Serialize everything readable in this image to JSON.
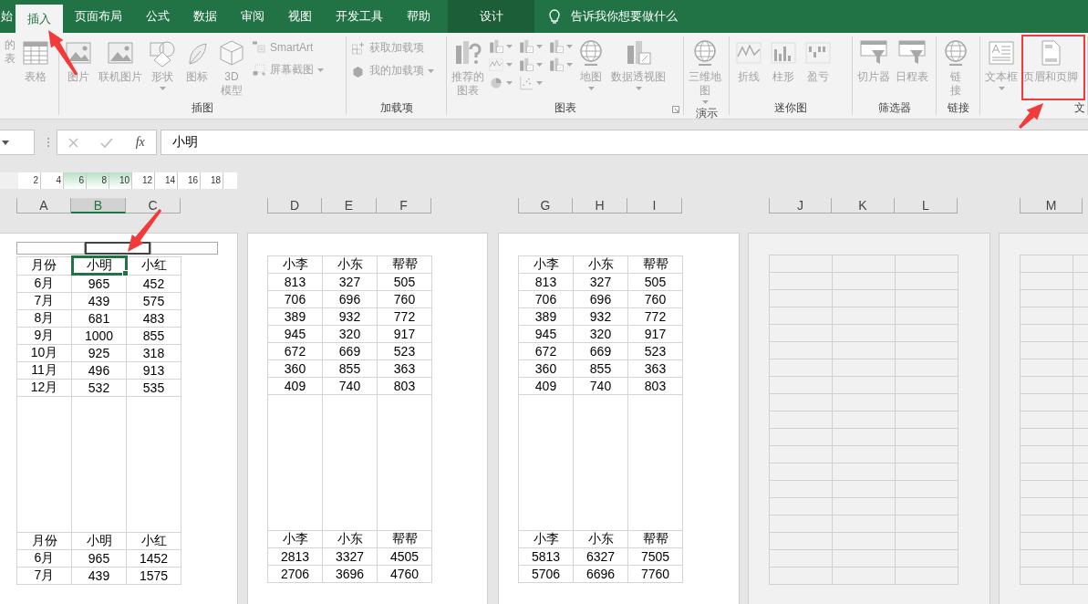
{
  "tabs": [
    {
      "label": "始",
      "selected": false,
      "kind": "normal"
    },
    {
      "label": "插入",
      "selected": true,
      "kind": "normal"
    },
    {
      "label": "页面布局",
      "selected": false,
      "kind": "normal"
    },
    {
      "label": "公式",
      "selected": false,
      "kind": "normal"
    },
    {
      "label": "数据",
      "selected": false,
      "kind": "normal"
    },
    {
      "label": "审阅",
      "selected": false,
      "kind": "normal"
    },
    {
      "label": "视图",
      "selected": false,
      "kind": "normal"
    },
    {
      "label": "开发工具",
      "selected": false,
      "kind": "normal"
    },
    {
      "label": "帮助",
      "selected": false,
      "kind": "normal"
    },
    {
      "label": "设计",
      "selected": false,
      "kind": "contextual"
    }
  ],
  "tell_me": "告诉我你想要做什么",
  "ribbon_groups": [
    {
      "buttons": [
        {
          "label": "的表",
          "kind": "large",
          "dropdown": false,
          "disabled": true
        },
        {
          "label": "表格",
          "kind": "large",
          "dropdown": false,
          "disabled": true
        }
      ]
    },
    {
      "label": "插图",
      "buttons": [
        {
          "label": "图片",
          "kind": "large",
          "dropdown": false,
          "disabled": true
        },
        {
          "label": "联机图片",
          "kind": "large",
          "dropdown": false,
          "disabled": true
        },
        {
          "label": "形状",
          "kind": "large",
          "dropdown": true,
          "disabled": true
        },
        {
          "label": "图标",
          "kind": "large",
          "dropdown": false,
          "disabled": true
        },
        {
          "label": "3D模型",
          "kind": "large",
          "dropdown": false,
          "disabled": true
        },
        {
          "label": "SmartArt",
          "kind": "small",
          "dropdown": false,
          "disabled": true
        },
        {
          "label": "屏幕截图",
          "kind": "small",
          "dropdown": true,
          "disabled": true
        }
      ]
    },
    {
      "label": "加载项",
      "buttons": [
        {
          "label": "获取加载项",
          "kind": "small",
          "dropdown": false,
          "disabled": true
        },
        {
          "label": "我的加载项",
          "kind": "small",
          "dropdown": true,
          "disabled": true
        }
      ]
    },
    {
      "label": "图表",
      "launcher": true,
      "buttons": [
        {
          "label": "推荐的图表",
          "kind": "large",
          "dropdown": false,
          "disabled": true
        },
        {
          "kind": "chart_grid",
          "disabled": true
        },
        {
          "label": "地图",
          "kind": "large",
          "dropdown": true,
          "disabled": true
        },
        {
          "label": "数据透视图",
          "kind": "large",
          "dropdown": true,
          "disabled": true
        }
      ]
    },
    {
      "label": "演示",
      "buttons": [
        {
          "label": "三维地图",
          "kind": "large",
          "dropdown": true,
          "disabled": true
        }
      ]
    },
    {
      "label": "迷你图",
      "buttons": [
        {
          "label": "折线",
          "kind": "large",
          "dropdown": false,
          "disabled": true
        },
        {
          "label": "柱形",
          "kind": "large",
          "dropdown": false,
          "disabled": true
        },
        {
          "label": "盈亏",
          "kind": "large",
          "dropdown": false,
          "disabled": true
        }
      ]
    },
    {
      "label": "筛选器",
      "buttons": [
        {
          "label": "切片器",
          "kind": "large",
          "dropdown": false,
          "disabled": true
        },
        {
          "label": "日程表",
          "kind": "large",
          "dropdown": false,
          "disabled": true
        }
      ]
    },
    {
      "label": "链接",
      "buttons": [
        {
          "label": "链接",
          "kind": "large",
          "dropdown": false,
          "disabled": true
        }
      ]
    },
    {
      "label": "文",
      "buttons": [
        {
          "label": "文本框",
          "kind": "large",
          "dropdown": true,
          "disabled": true
        },
        {
          "label": "页眉和页脚",
          "kind": "large",
          "dropdown": false,
          "disabled": true
        }
      ]
    }
  ],
  "formula_bar": {
    "function_label": "fx",
    "value": "小明"
  },
  "ruler": [
    {
      "label": "2",
      "highlighted": false
    },
    {
      "label": "4",
      "highlighted": false
    },
    {
      "label": "6",
      "highlighted": true
    },
    {
      "label": "8",
      "highlighted": true
    },
    {
      "label": "10",
      "highlighted": true
    },
    {
      "label": "12",
      "highlighted": false
    },
    {
      "label": "14",
      "highlighted": false
    },
    {
      "label": "16",
      "highlighted": false
    },
    {
      "label": "18",
      "highlighted": false
    }
  ],
  "pages": [
    {
      "kind": "printed",
      "columns": [
        {
          "label": "A",
          "selected": false
        },
        {
          "label": "B",
          "selected": true
        },
        {
          "label": "C",
          "selected": false
        }
      ],
      "header_sections": [
        {
          "selected": false
        },
        {
          "selected": true
        },
        {
          "selected": false
        }
      ],
      "blocks": [
        {
          "header": [
            {
              "text": "月份",
              "selected": false
            },
            {
              "text": "小明",
              "selected": true
            },
            {
              "text": "小红",
              "selected": false
            }
          ],
          "rows": [
            [
              "6月",
              "965",
              "452"
            ],
            [
              "7月",
              "439",
              "575"
            ],
            [
              "8月",
              "681",
              "483"
            ],
            [
              "9月",
              "1000",
              "855"
            ],
            [
              "10月",
              "925",
              "318"
            ],
            [
              "11月",
              "496",
              "913"
            ],
            [
              "12月",
              "532",
              "535"
            ]
          ]
        },
        {
          "header": [
            {
              "text": "月份",
              "selected": false
            },
            {
              "text": "小明",
              "selected": false
            },
            {
              "text": "小红",
              "selected": false
            }
          ],
          "rows": [
            [
              "6月",
              "965",
              "1452"
            ],
            [
              "7月",
              "439",
              "1575"
            ]
          ]
        }
      ]
    },
    {
      "kind": "printed",
      "columns": [
        {
          "label": "D",
          "selected": false
        },
        {
          "label": "E",
          "selected": false
        },
        {
          "label": "F",
          "selected": false
        }
      ],
      "blocks": [
        {
          "header": [
            {
              "text": "小李",
              "selected": false
            },
            {
              "text": "小东",
              "selected": false
            },
            {
              "text": "帮帮",
              "selected": false
            }
          ],
          "rows": [
            [
              "813",
              "327",
              "505"
            ],
            [
              "706",
              "696",
              "760"
            ],
            [
              "389",
              "932",
              "772"
            ],
            [
              "945",
              "320",
              "917"
            ],
            [
              "672",
              "669",
              "523"
            ],
            [
              "360",
              "855",
              "363"
            ],
            [
              "409",
              "740",
              "803"
            ]
          ]
        },
        {
          "header": [
            {
              "text": "小李",
              "selected": false
            },
            {
              "text": "小东",
              "selected": false
            },
            {
              "text": "帮帮",
              "selected": false
            }
          ],
          "rows": [
            [
              "2813",
              "3327",
              "4505"
            ],
            [
              "2706",
              "3696",
              "4760"
            ]
          ]
        }
      ]
    },
    {
      "kind": "printed",
      "columns": [
        {
          "label": "G",
          "selected": false
        },
        {
          "label": "H",
          "selected": false
        },
        {
          "label": "I",
          "selected": false
        }
      ],
      "blocks": [
        {
          "header": [
            {
              "text": "小李",
              "selected": false
            },
            {
              "text": "小东",
              "selected": false
            },
            {
              "text": "帮帮",
              "selected": false
            }
          ],
          "rows": [
            [
              "813",
              "327",
              "505"
            ],
            [
              "706",
              "696",
              "760"
            ],
            [
              "389",
              "932",
              "772"
            ],
            [
              "945",
              "320",
              "917"
            ],
            [
              "672",
              "669",
              "523"
            ],
            [
              "360",
              "855",
              "363"
            ],
            [
              "409",
              "740",
              "803"
            ]
          ]
        },
        {
          "header": [
            {
              "text": "小李",
              "selected": false
            },
            {
              "text": "小东",
              "selected": false
            },
            {
              "text": "帮帮",
              "selected": false
            }
          ],
          "rows": [
            [
              "5813",
              "6327",
              "7505"
            ],
            [
              "5706",
              "6696",
              "7760"
            ]
          ]
        }
      ]
    },
    {
      "kind": "blank",
      "columns": [
        {
          "label": "J",
          "selected": false
        },
        {
          "label": "K",
          "selected": false
        },
        {
          "label": "L",
          "selected": false
        }
      ]
    },
    {
      "kind": "blank",
      "columns": [
        {
          "label": "M",
          "selected": false
        }
      ]
    }
  ]
}
